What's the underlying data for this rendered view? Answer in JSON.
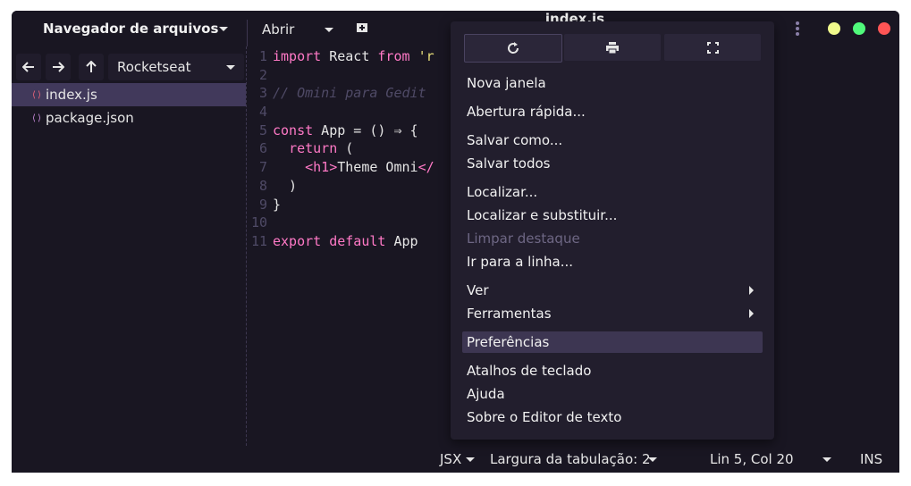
{
  "window": {
    "title": "index.js",
    "colors": {
      "minimize": "#f1fa8c",
      "maximize": "#50fa7b",
      "close": "#ff5555"
    }
  },
  "sidebar": {
    "title": "Navegador de arquivos",
    "location": "Rocketseat",
    "files": [
      {
        "name": "index.js",
        "icon": "code-file-icon"
      },
      {
        "name": "package.json",
        "icon": "code-file-icon"
      }
    ]
  },
  "header": {
    "open_label": "Abrir"
  },
  "editor": {
    "line_numbers": [
      "1",
      "2",
      "3",
      "4",
      "5",
      "6",
      "7",
      "8",
      "9",
      "10",
      "11"
    ],
    "lines": [
      "import React from 'r",
      "",
      "// Omini para Gedit",
      "",
      "const App = () ⇒ {",
      "  return (",
      "    <h1>Theme Omni</",
      "  )",
      "}",
      "",
      "export default App"
    ]
  },
  "statusbar": {
    "language": "JSX",
    "tab_width": "Largura da tabulação: 2",
    "position": "Lin 5, Col 20",
    "mode": "INS"
  },
  "menu": {
    "top_icons": [
      "reload-icon",
      "print-icon",
      "fullscreen-icon"
    ],
    "items": [
      {
        "label": "Nova janela"
      },
      {
        "label": "Abertura rápida..."
      },
      {
        "label": "Salvar como..."
      },
      {
        "label": "Salvar todos"
      },
      {
        "label": "Localizar..."
      },
      {
        "label": "Localizar e substituir..."
      },
      {
        "label": "Limpar destaque",
        "disabled": true
      },
      {
        "label": "Ir para a linha..."
      },
      {
        "label": "Ver",
        "submenu": true
      },
      {
        "label": "Ferramentas",
        "submenu": true
      },
      {
        "label": "Preferências",
        "highlighted": true
      },
      {
        "label": "Atalhos de teclado"
      },
      {
        "label": "Ajuda"
      },
      {
        "label": "Sobre o Editor de texto"
      }
    ]
  }
}
